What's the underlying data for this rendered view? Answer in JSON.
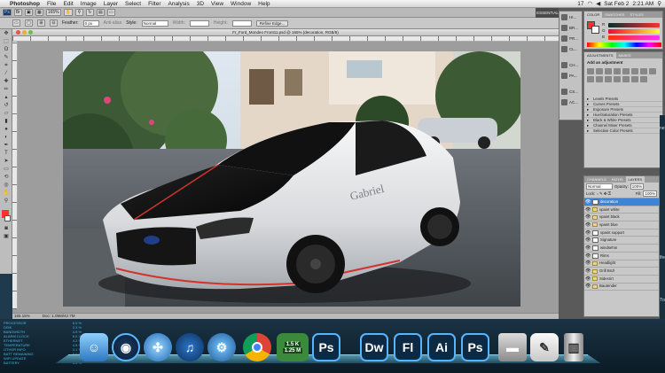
{
  "menubar": {
    "apple": "",
    "app_name": "Photoshop",
    "menus": [
      "File",
      "Edit",
      "Image",
      "Layer",
      "Select",
      "Filter",
      "Analysis",
      "3D",
      "View",
      "Window",
      "Help"
    ],
    "status_items": [
      "17",
      "Sat Feb 2",
      "2:21 AM"
    ]
  },
  "appbar": {
    "zoom": "165%",
    "workspace": "ESSENTIALS"
  },
  "options": {
    "feather_label": "Feather:",
    "feather_value": "0 px",
    "antialias_label": "Anti-alias",
    "style_label": "Style:",
    "style_value": "Normal",
    "width_label": "Width:",
    "height_label": "Height:",
    "refine_button": "Refine Edge..."
  },
  "document": {
    "title": "Fr_Ford_Mondeo Front11.psd @ 165% (decoration, RGB/8)",
    "status_zoom": "165.15%",
    "status_doc": "Doc: 1.05M/42.7M"
  },
  "panels": {
    "icon_column": [
      {
        "label": "HI..."
      },
      {
        "label": "BR..."
      },
      {
        "label": "PR..."
      },
      {
        "label": "CL..."
      },
      {
        "label": "CH..."
      },
      {
        "label": "PA..."
      },
      {
        "label": "CS..."
      },
      {
        "label": "AC..."
      }
    ],
    "color": {
      "tabs": [
        "COLOR",
        "SWATCHES",
        "STYLES"
      ],
      "r_label": "R",
      "g_label": "G",
      "b_label": "B",
      "r_value": "255",
      "g_value": "48",
      "b_value": "48",
      "fg_color": "#ff3030",
      "bg_color": "#ffffff"
    },
    "adjustments": {
      "tabs": [
        "ADJUSTMENTS",
        "MASKS"
      ],
      "heading": "Add an adjustment",
      "presets": [
        "Levels Presets",
        "Curves Presets",
        "Exposure Presets",
        "Hue/Saturation Presets",
        "Black & White Presets",
        "Channel Mixer Presets",
        "Selective Color Presets"
      ]
    },
    "layers": {
      "tabs": [
        "CHANNELS",
        "PATHS",
        "LAYERS"
      ],
      "blend_mode": "Normal",
      "opacity_label": "Opacity:",
      "opacity_value": "100%",
      "lock_label": "Lock:",
      "fill_label": "Fill:",
      "fill_value": "100%",
      "items": [
        {
          "name": "decoration",
          "type": "layer",
          "selected": true
        },
        {
          "name": "vpaint white",
          "type": "folder",
          "selected": false
        },
        {
          "name": "vpaint black",
          "type": "folder",
          "selected": false
        },
        {
          "name": "vpaint blue",
          "type": "folder",
          "selected": false
        },
        {
          "name": "vpaint support",
          "type": "layer",
          "selected": false
        },
        {
          "name": "Signature",
          "type": "layer",
          "selected": false
        },
        {
          "name": "windsehin",
          "type": "layer",
          "selected": false
        },
        {
          "name": "Rims",
          "type": "layer",
          "selected": false
        },
        {
          "name": "Headlight",
          "type": "folder",
          "selected": false
        },
        {
          "name": "Grill Bnzl",
          "type": "folder",
          "selected": false
        },
        {
          "name": "Sidesrirt",
          "type": "folder",
          "selected": false
        },
        {
          "name": "Bautender",
          "type": "folder",
          "selected": false
        }
      ]
    }
  },
  "desktop": {
    "labels": [
      "nesto",
      "lfect",
      "Trans"
    ]
  },
  "dock": {
    "items": [
      {
        "name": "finder-icon",
        "label": ""
      },
      {
        "name": "radar-icon",
        "label": ""
      },
      {
        "name": "safari-icon",
        "label": ""
      },
      {
        "name": "itunes-icon",
        "label": "♫"
      },
      {
        "name": "system-prefs-icon",
        "label": ""
      },
      {
        "name": "chrome-icon",
        "label": ""
      },
      {
        "name": "network-meter-icon",
        "label": ""
      },
      {
        "name": "photoshop-icon",
        "label": "Ps"
      },
      {
        "name": "dreamweaver-icon",
        "label": "Dw"
      },
      {
        "name": "flash-icon",
        "label": "Fl"
      },
      {
        "name": "illustrator-icon",
        "label": "Ai"
      },
      {
        "name": "photoshop2-icon",
        "label": "Ps"
      },
      {
        "name": "drive-icon",
        "label": ""
      },
      {
        "name": "textedit-icon",
        "label": ""
      },
      {
        "name": "trash-icon",
        "label": ""
      }
    ],
    "net_up": "1.5 K",
    "net_down": "1.25 M"
  },
  "mini_panel": {
    "rows": [
      [
        "PROCESSOR",
        "6.0 %"
      ],
      [
        "DISK",
        "2.3 %"
      ],
      [
        "BANDWIDTH",
        "4.5 %"
      ],
      [
        "ALARM CLOCK",
        "6.0 %"
      ],
      [
        "ETHERNET",
        "4.2 %"
      ],
      [
        "TEMPERATURE",
        "4.5 %"
      ],
      [
        "OTHER INFO",
        "4.1 %"
      ],
      [
        "BATT REMAINING",
        "0.0 %"
      ],
      [
        "WIFI UPDATE",
        "0.9 %"
      ],
      [
        "BATTERY",
        "3.3 %"
      ]
    ]
  }
}
